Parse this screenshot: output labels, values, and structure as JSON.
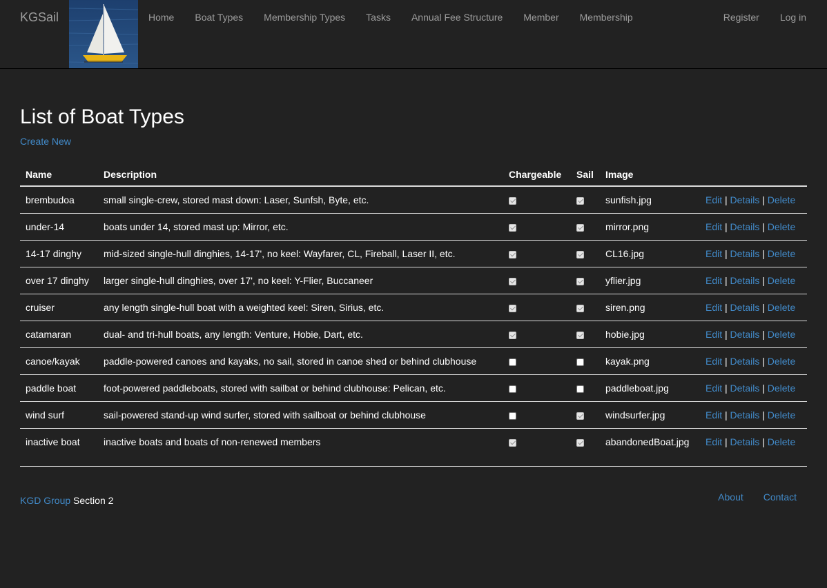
{
  "nav": {
    "brand": "KGSail",
    "left_items": [
      {
        "label": "Home"
      },
      {
        "label": "Boat Types"
      },
      {
        "label": "Membership Types"
      },
      {
        "label": "Tasks"
      },
      {
        "label": "Annual Fee Structure"
      },
      {
        "label": "Member"
      },
      {
        "label": "Membership"
      }
    ],
    "right_items": [
      {
        "label": "Register"
      },
      {
        "label": "Log in"
      }
    ]
  },
  "page": {
    "title": "List of Boat Types",
    "create_new": "Create New"
  },
  "table": {
    "headers": [
      "Name",
      "Description",
      "Chargeable",
      "Sail",
      "Image"
    ],
    "rows": [
      {
        "name": "brembudoa",
        "description": "small single-crew, stored mast down: Laser, Sunfsh, Byte, etc.",
        "chargeable": true,
        "sail": true,
        "image": "sunfish.jpg"
      },
      {
        "name": "under-14",
        "description": "boats under 14, stored mast up: Mirror, etc.",
        "chargeable": true,
        "sail": true,
        "image": "mirror.png"
      },
      {
        "name": "14-17 dinghy",
        "description": "mid-sized single-hull dinghies, 14-17', no keel: Wayfarer, CL, Fireball, Laser II, etc.",
        "chargeable": true,
        "sail": true,
        "image": "CL16.jpg"
      },
      {
        "name": "over 17 dinghy",
        "description": "larger single-hull dinghies, over 17', no keel: Y-Flier, Buccaneer",
        "chargeable": true,
        "sail": true,
        "image": "yflier.jpg"
      },
      {
        "name": "cruiser",
        "description": "any length single-hull boat with a weighted keel: Siren, Sirius, etc.",
        "chargeable": true,
        "sail": true,
        "image": "siren.png"
      },
      {
        "name": "catamaran",
        "description": "dual- and tri-hull boats, any length: Venture, Hobie, Dart, etc.",
        "chargeable": true,
        "sail": true,
        "image": "hobie.jpg"
      },
      {
        "name": "canoe/kayak",
        "description": "paddle-powered canoes and kayaks, no sail, stored in canoe shed or behind clubhouse",
        "chargeable": false,
        "sail": false,
        "image": "kayak.png"
      },
      {
        "name": "paddle boat",
        "description": "foot-powered paddleboats, stored with sailbat or behind clubhouse: Pelican, etc.",
        "chargeable": false,
        "sail": false,
        "image": "paddleboat.jpg"
      },
      {
        "name": "wind surf",
        "description": "sail-powered stand-up wind surfer, stored with sailboat or behind clubhouse",
        "chargeable": false,
        "sail": true,
        "image": "windsurfer.jpg"
      },
      {
        "name": "inactive boat",
        "description": "inactive boats and boats of non-renewed members",
        "chargeable": true,
        "sail": true,
        "image": "abandonedBoat.jpg"
      }
    ],
    "actions": {
      "edit": "Edit",
      "details": "Details",
      "delete": "Delete",
      "separator": "|"
    }
  },
  "footer": {
    "group_link": "KGD Group",
    "section_text": " Section 2",
    "links": [
      {
        "label": "About"
      },
      {
        "label": "Contact"
      }
    ]
  },
  "colors": {
    "background": "#222222",
    "nav_text": "#9d9d9d",
    "link": "#428bca",
    "text": "#ffffff",
    "rule": "#dddddd"
  },
  "icons": {
    "logo": "sailboat-logo-image"
  }
}
